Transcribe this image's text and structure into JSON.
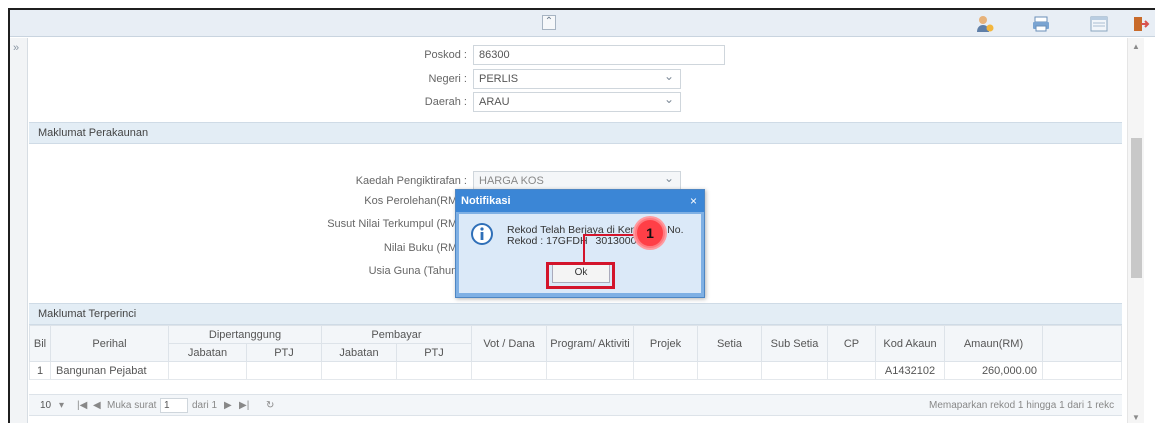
{
  "form": {
    "poskod_label": "Poskod :",
    "poskod_value": "86300",
    "negeri_label": "Negeri :",
    "negeri_value": "PERLIS",
    "daerah_label": "Daerah :",
    "daerah_value": "ARAU"
  },
  "sections": {
    "perakaunan": "Maklumat Perakaunan",
    "terperinci": "Maklumat Terperinci"
  },
  "accounting": {
    "kaedah_label": "Kaedah Pengiktirafan :",
    "kaedah_value": "HARGA KOS",
    "kos_label": "Kos Perolehan(RM) :",
    "susut_label": "Susut Nilai Terkumpul (RM) :",
    "nilai_label": "Nilai Buku (RM) :",
    "usia_label": "Usia Guna (Tahun) :"
  },
  "table": {
    "headers": {
      "bil": "Bil",
      "perihal": "Perihal",
      "dipertanggung": "Dipertanggung",
      "pembayar": "Pembayar",
      "jabatan1": "Jabatan",
      "ptj1": "PTJ",
      "jabatan2": "Jabatan",
      "ptj2": "PTJ",
      "vot": "Vot / Dana",
      "program": "Program/ Aktiviti",
      "projek": "Projek",
      "setia": "Setia",
      "subsetia": "Sub Setia",
      "cp": "CP",
      "kodakaun": "Kod Akaun",
      "amaun": "Amaun(RM)"
    },
    "row": {
      "bil": "1",
      "perihal": "Bangunan Pejabat",
      "kodakaun": "A1432102",
      "amaun": "260,000.00"
    }
  },
  "pager": {
    "page_size": "10",
    "muka_label": "Muka surat",
    "page_value": "1",
    "dari_label": "dari 1",
    "summary": "Memaparkan rekod 1 hingga 1 dari 1 rekc"
  },
  "dialog": {
    "title": "Notifikasi",
    "close": "×",
    "message_line1": "Rekod Telah Berjaya di Kema",
    "message_line1b": "No.",
    "message_line2": "Rekod : 17GFDH",
    "message_line2b": "30130006",
    "ok_label": "Ok"
  },
  "callout": {
    "number": "1",
    "color": "#d3142b"
  },
  "colors": {
    "titlebar": "#3b86d6",
    "section_bg": "#e3edf5"
  },
  "icons": {
    "collapse": "double-chevron-up-icon",
    "user_help": "user-icon",
    "printer": "printer-icon",
    "window": "window-icon",
    "logout": "logout-icon",
    "info": "info-icon"
  }
}
